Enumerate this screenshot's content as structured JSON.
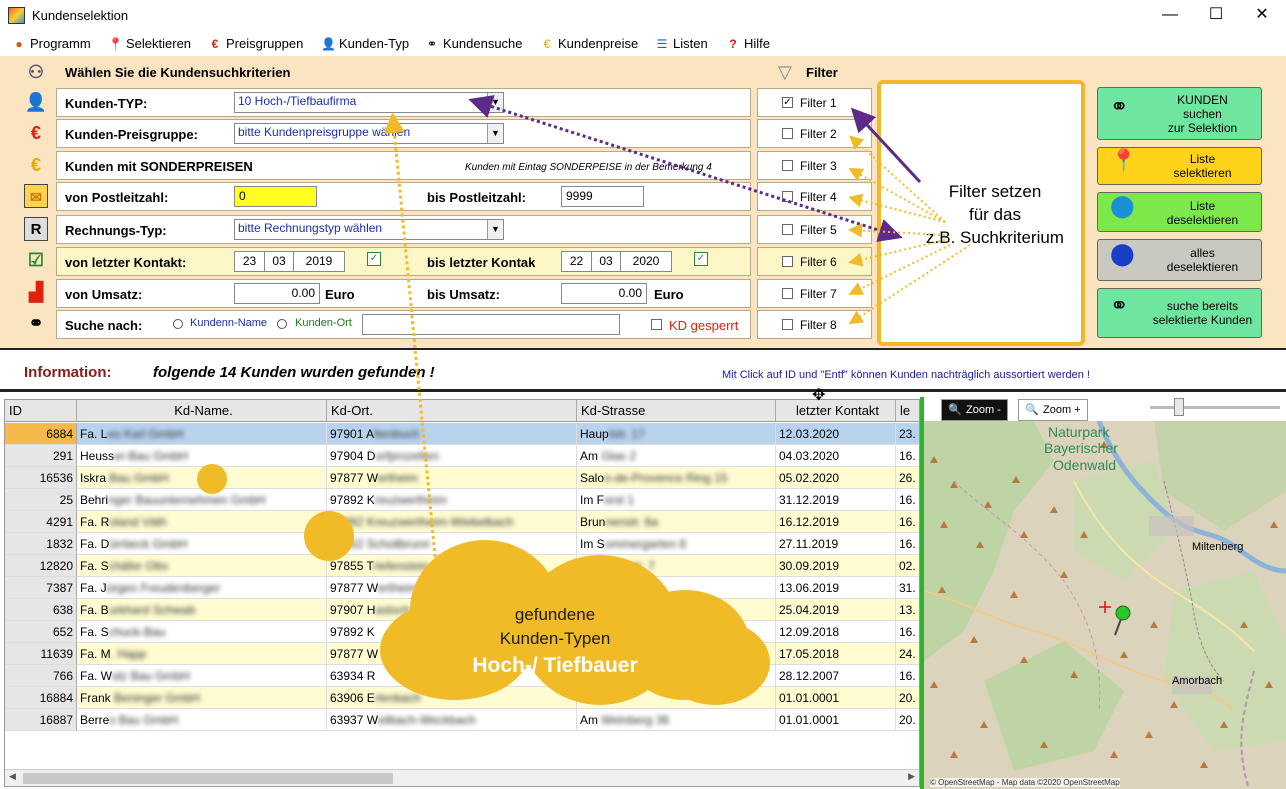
{
  "window": {
    "title": "Kundenselektion",
    "minimize": "—",
    "maximize": "☐",
    "close": "✕"
  },
  "menu": [
    "Programm",
    "Selektieren",
    "Preisgruppen",
    "Kunden-Typ",
    "Kundensuche",
    "Kundenpreise",
    "Listen",
    "Hilfe"
  ],
  "menu_icons": [
    "globe-icon",
    "pin-icon",
    "euro-icon",
    "person-icon",
    "binoculars-icon",
    "coins-icon",
    "list-icon",
    "help-icon"
  ],
  "criteria": {
    "header": "Wählen Sie die Kundensuchkriterien",
    "filter_header": "Filter",
    "kunden_typ": {
      "label": "Kunden-TYP:",
      "value": "10  Hoch-/Tiefbaufirma"
    },
    "preisgruppe": {
      "label": "Kunden-Preisgruppe:",
      "value": "bitte Kundenpreisgruppe wählen"
    },
    "sonderpreise": {
      "label": "Kunden mit SONDERPREISEN",
      "note": "Kunden mit Eintag SONDERPEISE in der Bemerkung 4"
    },
    "plz": {
      "label_from": "von Postleitzahl:",
      "value_from": "0",
      "label_to": "bis Postleitzahl:",
      "value_to": "9999"
    },
    "rechnung": {
      "label": "Rechnungs-Typ:",
      "value": "bitte Rechnungstyp wählen"
    },
    "kontakt": {
      "label_from": "von letzter Kontakt:",
      "from_d": "23",
      "from_m": "03",
      "from_y": "2019",
      "label_to": "bis letzter Kontak",
      "to_d": "22",
      "to_m": "03",
      "to_y": "2020"
    },
    "umsatz": {
      "label_from": "von Umsatz:",
      "value_from": "0.00",
      "unit": "Euro",
      "label_to": "bis Umsatz:",
      "value_to": "0.00"
    },
    "suche": {
      "label": "Suche nach:",
      "opt1": "Kundenn-Name",
      "opt2": "Kunden-Ort",
      "value": "",
      "gesperrt": "KD gesperrt"
    }
  },
  "filters": [
    {
      "label": "Filter 1",
      "checked": true
    },
    {
      "label": "Filter 2",
      "checked": false
    },
    {
      "label": "Filter 3",
      "checked": false
    },
    {
      "label": "Filter 4",
      "checked": false
    },
    {
      "label": "Filter 5",
      "checked": false
    },
    {
      "label": "Filter 6",
      "checked": false
    },
    {
      "label": "Filter 7",
      "checked": false
    },
    {
      "label": "Filter 8",
      "checked": false
    }
  ],
  "check_mark": "✓",
  "callout": {
    "line1": "Filter setzen",
    "line2": "für das",
    "line3": "z.B. Suchkriterium"
  },
  "buttons": [
    {
      "label": "KUNDEN\nsuchen\nzur Selektion",
      "icon": "binoculars-icon",
      "color": "#6fe6a0"
    },
    {
      "label": "Liste\nselektieren",
      "icon": "pin-icon",
      "color": "#ffd21a"
    },
    {
      "label": "Liste\ndeselektieren",
      "icon": "pins-icon",
      "color": "#7de84a"
    },
    {
      "label": "alles\ndeselektieren",
      "icon": "blue-pins-icon",
      "color": "#c9c9c1"
    },
    {
      "label": "suche bereits\nselektierte Kunden",
      "icon": "binoculars-icon",
      "color": "#6fe6a0"
    }
  ],
  "info": {
    "label": "Information:",
    "message": "folgende 14  Kunden wurden gefunden !",
    "hint": "Mit Click auf ID und \"Entf\" können Kunden nachträglich aussortiert werden !"
  },
  "table": {
    "columns": [
      "ID",
      "Kd-Name.",
      "Kd-Ort.",
      "Kd-Strasse",
      "letzter Kontakt",
      "le"
    ],
    "rows": [
      {
        "id": "6884",
        "name_vis": "Fa. L",
        "name_blur": "eo Karl GmbH",
        "ort_vis": "97901 A",
        "ort_blur": "ltenbuch",
        "str_vis": "Haup",
        "str_blur": "tstr. 17",
        "kontakt": "12.03.2020",
        "le": "23."
      },
      {
        "id": "291",
        "name_vis": "Heuss",
        "name_blur": "er-Bau GmbH",
        "ort_vis": "97904 D",
        "ort_blur": "orfprozelten",
        "str_vis": "Am ",
        "str_blur": "Glas 2",
        "kontakt": "04.03.2020",
        "le": "16."
      },
      {
        "id": "16536",
        "name_vis": "Iskra",
        "name_blur": " Bau GmbH",
        "ort_vis": "97877 W",
        "ort_blur": "ertheim",
        "str_vis": "Salo",
        "str_blur": "n-de-Provence Ring 15",
        "kontakt": "05.02.2020",
        "le": "26."
      },
      {
        "id": "25",
        "name_vis": "Behri",
        "name_blur": "nger Bauunternehmen GmbH",
        "ort_vis": "97892 K",
        "ort_blur": "reuzwertheim",
        "str_vis": "Im F",
        "str_blur": "orst 1",
        "kontakt": "31.12.2019",
        "le": "16."
      },
      {
        "id": "4291",
        "name_vis": "Fa. R",
        "name_blur": "oland Väth",
        "ort_vis": "97",
        "ort_blur": "892 Kreuzwertheim-Wiebelbach",
        "str_vis": "Brun",
        "str_blur": "nenstr. 6a",
        "kontakt": "16.12.2019",
        "le": "16."
      },
      {
        "id": "1832",
        "name_vis": "Fa. D",
        "name_blur": "ürrbeck GmbH",
        "ort_vis": "97",
        "ort_blur": "852 Schollbrunn",
        "str_vis": "Im S",
        "str_blur": "ommergarten 8",
        "kontakt": "27.11.2019",
        "le": "16."
      },
      {
        "id": "12820",
        "name_vis": "Fa. S",
        "name_blur": "chäfer Otto",
        "ort_vis": "97855 T",
        "ort_blur": "riefenstein",
        "str_vis": "",
        "str_blur": "Gewerbestr. 7",
        "kontakt": "30.09.2019",
        "le": "02."
      },
      {
        "id": "7387",
        "name_vis": "Fa. J",
        "name_blur": "ürgen Freudenberger",
        "ort_vis": "97877 W",
        "ort_blur": "ertheim",
        "str_vis": "",
        "str_blur": "",
        "kontakt": "13.06.2019",
        "le": "31."
      },
      {
        "id": "638",
        "name_vis": "Fa. B",
        "name_blur": "urkhard Schwab",
        "ort_vis": "97907 H",
        "ort_blur": "asloch",
        "str_vis": "",
        "str_blur": "",
        "kontakt": "25.04.2019",
        "le": "13."
      },
      {
        "id": "652",
        "name_vis": "Fa. S",
        "name_blur": "chuck-Bau",
        "ort_vis": "97892 K",
        "ort_blur": "",
        "str_vis": "",
        "str_blur": "",
        "kontakt": "12.09.2018",
        "le": "16."
      },
      {
        "id": "11639",
        "name_vis": "Fa. M",
        "name_blur": ". Happ",
        "ort_vis": "97877 W",
        "ort_blur": "",
        "str_vis": "",
        "str_blur": "",
        "kontakt": "17.05.2018",
        "le": "24."
      },
      {
        "id": "766",
        "name_vis": "Fa. W",
        "name_blur": "olz  Bau GmbH",
        "ort_vis": "63934 R",
        "ort_blur": "",
        "str_vis": "",
        "str_blur": "",
        "kontakt": "28.12.2007",
        "le": "16."
      },
      {
        "id": "16884",
        "name_vis": "Frank",
        "name_blur": " Beninger GmbH",
        "ort_vis": "63906 E",
        "ort_blur": "rlenbach",
        "str_vis": "",
        "str_blur": "",
        "kontakt": "01.01.0001",
        "le": "20."
      },
      {
        "id": "16887",
        "name_vis": "Berre",
        "name_blur": "s Bau GmbH",
        "ort_vis": "63937 W",
        "ort_blur": "eilbach-Weckbach",
        "str_vis": "Am ",
        "str_blur": "Weinberg 36",
        "kontakt": "01.01.0001",
        "le": "20."
      }
    ]
  },
  "row_colors": {
    "selected": "#b9d3ef",
    "selected_id": "#f5b84a",
    "alt": "#fffcd2",
    "plain": "#ffffff"
  },
  "map": {
    "zoom_out": "Zoom -",
    "zoom_in": "Zoom +",
    "zoom_level": 0.2,
    "labels": [
      "Naturpark",
      "Bayerischer",
      "Odenwald",
      "Miltenberg",
      "Amorbach"
    ],
    "attribution": "© OpenStreetMap - Map data ©2020 OpenStreetMap"
  },
  "cloud": {
    "line1": "gefundene",
    "line2": "Kunden-Typen",
    "line3": "Hoch-/ Tiefbauer"
  },
  "colors": {
    "accent_orange": "#f1bb28",
    "arrow_purple": "#5b2a8a",
    "panel_bg": "#fbe4c0",
    "splitter_green": "#2db42d"
  }
}
